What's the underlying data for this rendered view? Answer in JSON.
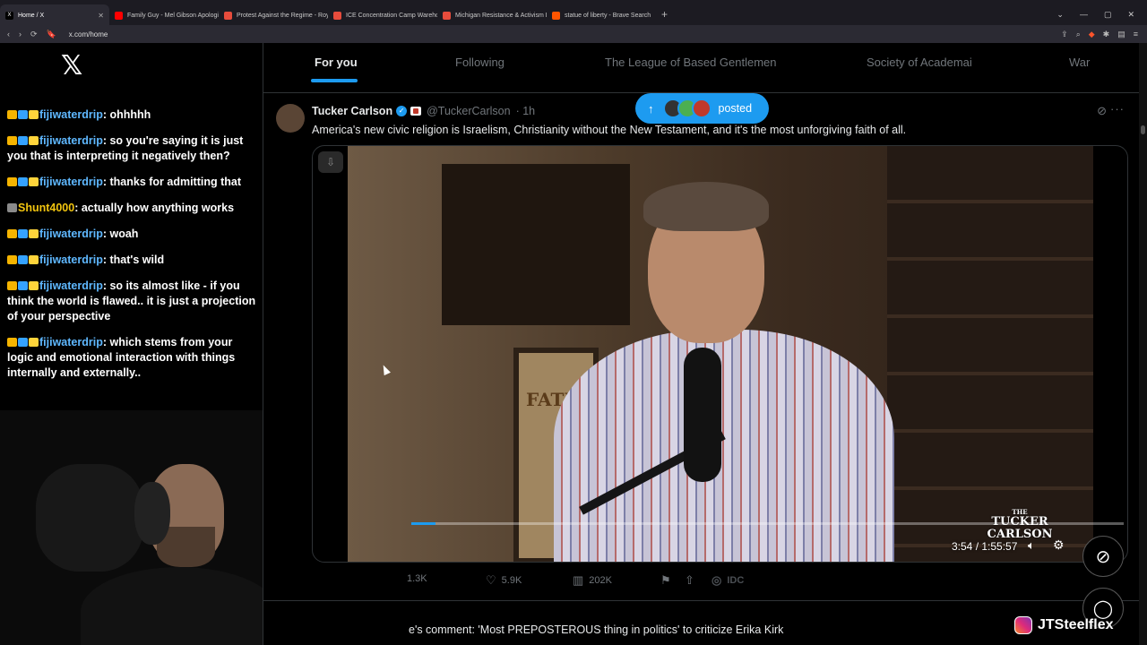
{
  "browser": {
    "tabs": [
      {
        "label": "Home / X",
        "fav": "X",
        "color": "#000000",
        "active": true
      },
      {
        "label": "Family Guy - Mel Gibson Apologizes",
        "fav": "",
        "color": "#ff0000",
        "active": false
      },
      {
        "label": "Protest Against the Regime - Royal O",
        "fav": "",
        "color": "#e74c3c",
        "active": false
      },
      {
        "label": "ICE Concentration Camp Warehouse",
        "fav": "",
        "color": "#e74c3c",
        "active": false
      },
      {
        "label": "Michigan Resistance & Activism Even",
        "fav": "",
        "color": "#e74c3c",
        "active": false
      },
      {
        "label": "statue of liberty - Brave Search",
        "fav": "",
        "color": "#ff5500",
        "active": false
      }
    ],
    "new_tab": "+",
    "url": "x.com/home",
    "nav_icons": [
      "‹",
      "›",
      "⟳",
      "🔖"
    ],
    "window_controls": [
      "⌄",
      "—",
      "▢",
      "✕"
    ]
  },
  "chat": {
    "logo": "𝕏",
    "messages": [
      {
        "user": "fijiwaterdrip",
        "text": ": ohhhhh",
        "user_color": "blue",
        "badges": [
          "b1",
          "b2",
          "b3"
        ]
      },
      {
        "user": "fijiwaterdrip",
        "text": ": so you're saying it is just you that is interpreting it negatively then?",
        "user_color": "blue",
        "badges": [
          "b1",
          "b2",
          "b3"
        ]
      },
      {
        "user": "fijiwaterdrip",
        "text": ": thanks for admitting that",
        "user_color": "blue",
        "badges": [
          "b1",
          "b2",
          "b3"
        ]
      },
      {
        "user": "Shunt4000",
        "text": ": actually how anything works",
        "user_color": "gold",
        "badges": [
          "b4"
        ]
      },
      {
        "user": "fijiwaterdrip",
        "text": ": woah",
        "user_color": "blue",
        "badges": [
          "b1",
          "b2",
          "b3"
        ]
      },
      {
        "user": "fijiwaterdrip",
        "text": ": that's wild",
        "user_color": "blue",
        "badges": [
          "b1",
          "b2",
          "b3"
        ]
      },
      {
        "user": "fijiwaterdrip",
        "text": ": so its almost like - if you think the world is flawed.. it is just a projection of your perspective",
        "user_color": "blue",
        "badges": [
          "b1",
          "b2",
          "b3"
        ]
      },
      {
        "user": "fijiwaterdrip",
        "text": ": which stems from your logic and emotional interaction with things internally and externally..",
        "user_color": "blue",
        "badges": [
          "b1",
          "b2",
          "b3"
        ]
      }
    ]
  },
  "timeline": {
    "tabs": [
      "For you",
      "Following",
      "The League of Based Gentlemen",
      "Society of Academai",
      "War"
    ],
    "active_tab": "For you",
    "posted_pill": {
      "arrow": "↑",
      "label": "posted"
    }
  },
  "tweet": {
    "name": "Tucker Carlson",
    "handle": "@TuckerCarlson",
    "time": "· 1h",
    "text": "America's new civic religion is Israelism, Christianity without the New Testament, and it's the most unforgiving faith of all.",
    "video": {
      "time": "3:54 / 1:55:57",
      "progress": 0.034,
      "poster_text": "FATIMA",
      "logo_small": "THE",
      "logo_line1": "TUCKER",
      "logo_line2": "CARLSON"
    },
    "actions": {
      "retweets": "1.3K",
      "likes": "5.9K",
      "views": "202K",
      "extra": "IDC"
    }
  },
  "next_tweet_text": "e's comment: 'Most PREPOSTEROUS thing in politics' to criticize Erika Kirk",
  "watermark": "JTSteelflex"
}
